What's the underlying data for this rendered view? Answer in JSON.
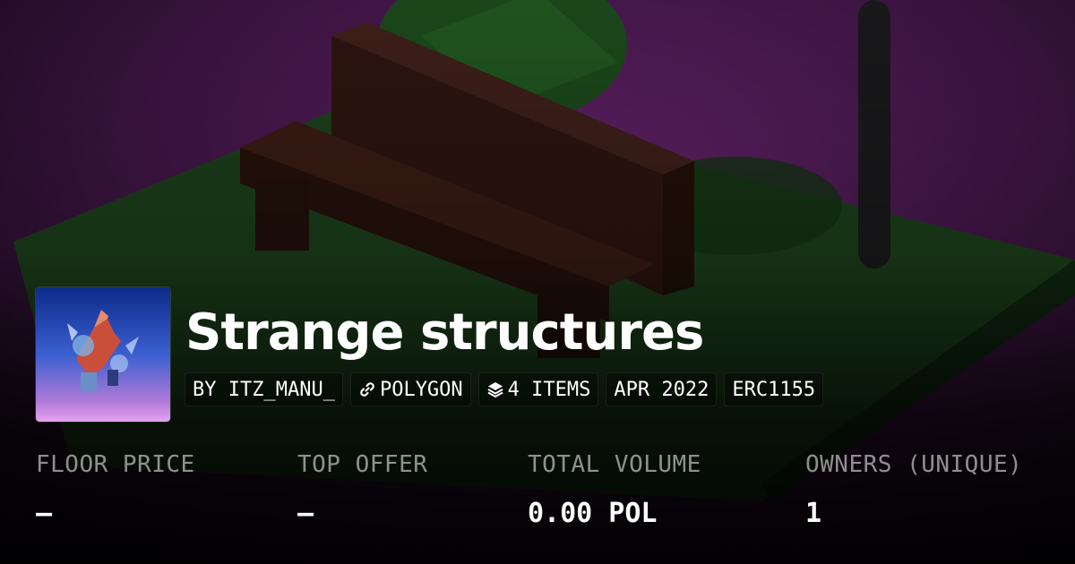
{
  "collection": {
    "title": "Strange structures",
    "chips": {
      "creator": "BY ITZ_MANU_",
      "chain": "POLYGON",
      "items": "4 ITEMS",
      "date": "APR 2022",
      "standard": "ERC1155"
    }
  },
  "stats": [
    {
      "label": "FLOOR PRICE",
      "value": "–"
    },
    {
      "label": "TOP OFFER",
      "value": "–"
    },
    {
      "label": "TOTAL VOLUME",
      "value": "0.00 POL"
    },
    {
      "label": "OWNERS (UNIQUE)",
      "value": "1"
    }
  ],
  "icons": {
    "chain": "polygon-link-icon",
    "items": "layers-icon"
  },
  "colors": {
    "background_purple": "#5a1f5e",
    "grass_green": "#1f4a1e",
    "bench_brown": "#3a1a12",
    "label_gray": "#8c8c8c",
    "text_white": "#ffffff"
  }
}
